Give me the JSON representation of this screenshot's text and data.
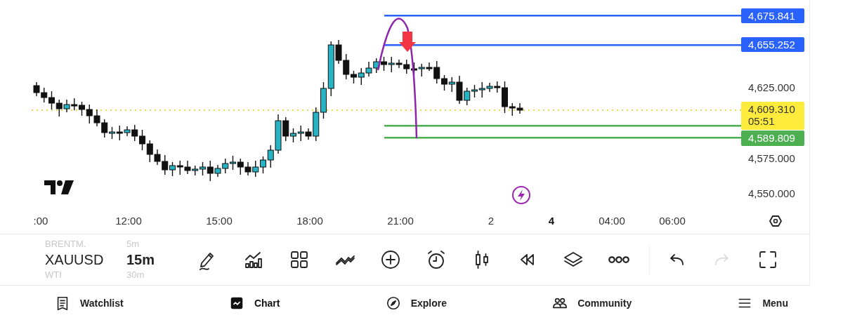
{
  "chart": {
    "price_labels": [
      "4,625.000",
      "4,575.000",
      "4,550.000"
    ],
    "price_tags": [
      {
        "text": "4,675.841",
        "color": "#2962ff"
      },
      {
        "text": "4,655.252",
        "color": "#2962ff"
      },
      {
        "text": "4,609.310",
        "countdown": "05:51",
        "color": "#ffeb3b"
      },
      {
        "text": "4,589.809",
        "color": "#4caf50"
      }
    ],
    "time_labels": [
      {
        "text": ":00",
        "highlighted": false
      },
      {
        "text": "12:00",
        "highlighted": false
      },
      {
        "text": "15:00",
        "highlighted": false
      },
      {
        "text": "18:00",
        "highlighted": false
      },
      {
        "text": "21:00",
        "highlighted": false
      },
      {
        "text": "2",
        "highlighted": false
      },
      {
        "text": "4",
        "highlighted": true
      },
      {
        "text": "04:00",
        "highlighted": false
      },
      {
        "text": "06:00",
        "highlighted": false
      }
    ]
  },
  "toolbar": {
    "symbols": [
      {
        "symbol": "BRENTM.",
        "interval": "5m",
        "selected": false
      },
      {
        "symbol": "XAUUSD",
        "interval": "15m",
        "selected": true
      },
      {
        "symbol": "WTI",
        "interval": "30m",
        "selected": false
      }
    ],
    "tools": [
      {
        "kind": "draw",
        "disabled": false
      },
      {
        "kind": "indicators",
        "disabled": false
      },
      {
        "kind": "layout",
        "disabled": false
      },
      {
        "kind": "patterns",
        "disabled": false
      },
      {
        "kind": "add",
        "disabled": false
      },
      {
        "kind": "alert",
        "disabled": false
      },
      {
        "kind": "candles",
        "disabled": false
      },
      {
        "kind": "replay",
        "disabled": false
      },
      {
        "kind": "layers",
        "disabled": false
      },
      {
        "kind": "more",
        "disabled": false
      },
      {
        "kind": "undo",
        "disabled": false
      },
      {
        "kind": "redo",
        "disabled": true
      },
      {
        "kind": "fullscreen",
        "disabled": false
      }
    ]
  },
  "nav": [
    {
      "label": "Watchlist",
      "kind": "watchlist",
      "selected": false
    },
    {
      "label": "Chart",
      "kind": "chart",
      "selected": true
    },
    {
      "label": "Explore",
      "kind": "explore",
      "selected": false
    },
    {
      "label": "Community",
      "kind": "community",
      "selected": false
    },
    {
      "label": "Menu",
      "kind": "menu",
      "selected": false
    }
  ]
}
